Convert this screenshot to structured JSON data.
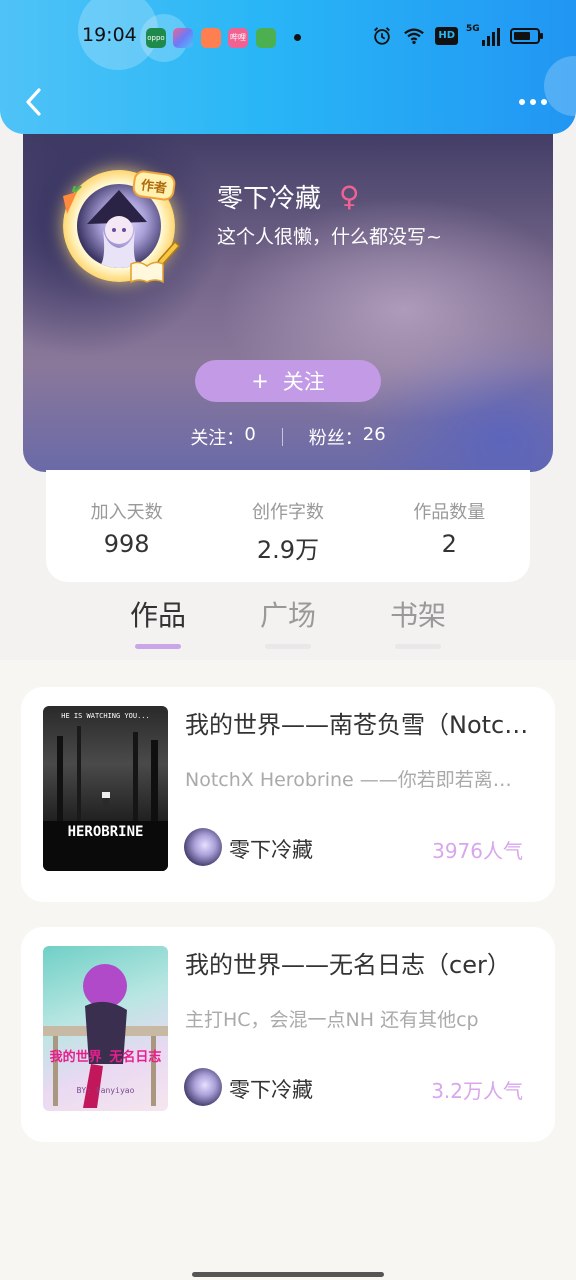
{
  "status_bar": {
    "time": "19:04",
    "apps": [
      {
        "name": "oppo-app-icon",
        "color": "#1e8a4c",
        "text": "oppo"
      },
      {
        "name": "assistant-app-icon",
        "color": "#6c7bf7",
        "text": ""
      },
      {
        "name": "books-app-icon",
        "color": "#ff7f50",
        "text": ""
      },
      {
        "name": "bilibili-app-icon",
        "color": "#f06292",
        "text": "哔哩"
      },
      {
        "name": "multitask-app-icon",
        "color": "#4caf50",
        "text": ""
      }
    ],
    "hd_label": "HD",
    "signal_label": "5G",
    "battery_level": 0.6
  },
  "header": {
    "back_icon": "chevron-left-icon",
    "more_icon": "more-dots-icon"
  },
  "profile": {
    "author_tag": "作者",
    "name": "零下冷藏",
    "gender_symbol": "♀",
    "bio": "这个人很懒，什么都没写~",
    "follow_button": {
      "icon": "+",
      "label": "关注"
    },
    "following": {
      "label": "关注：",
      "value": "0"
    },
    "fans": {
      "label": "粉丝：",
      "value": "26"
    }
  },
  "stats": [
    {
      "label": "加入天数",
      "value": "998"
    },
    {
      "label": "创作字数",
      "value": "2.9万"
    },
    {
      "label": "作品数量",
      "value": "2"
    }
  ],
  "tabs": [
    {
      "label": "作品",
      "active": true
    },
    {
      "label": "广场",
      "active": false
    },
    {
      "label": "书架",
      "active": false
    }
  ],
  "books": [
    {
      "title": "我的世界——南苍负雪（NotchX Herobrine）",
      "desc": "NotchX Herobrine ——你若即若离的背影",
      "author": "零下冷藏",
      "popularity": "3976人气",
      "cover_top_text": "HE IS WATCHING YOU...",
      "cover_main_text": "HEROBRINE"
    },
    {
      "title": "我的世界——无名日志（cer）",
      "desc": "主打HC，会混一点NH 还有其他cp",
      "author": "零下冷藏",
      "popularity": "3.2万人气",
      "cover_main_text": "我的世界 无名日志",
      "cover_sub_text": "BY: Fanyiyao"
    }
  ],
  "colors": {
    "header_blue": "#29b6f6",
    "follow_purple": "#c39ae6",
    "tab_underline": "#c9a6ea",
    "popularity_pink": "#d8a6ec",
    "gender_pink": "#f06292"
  }
}
